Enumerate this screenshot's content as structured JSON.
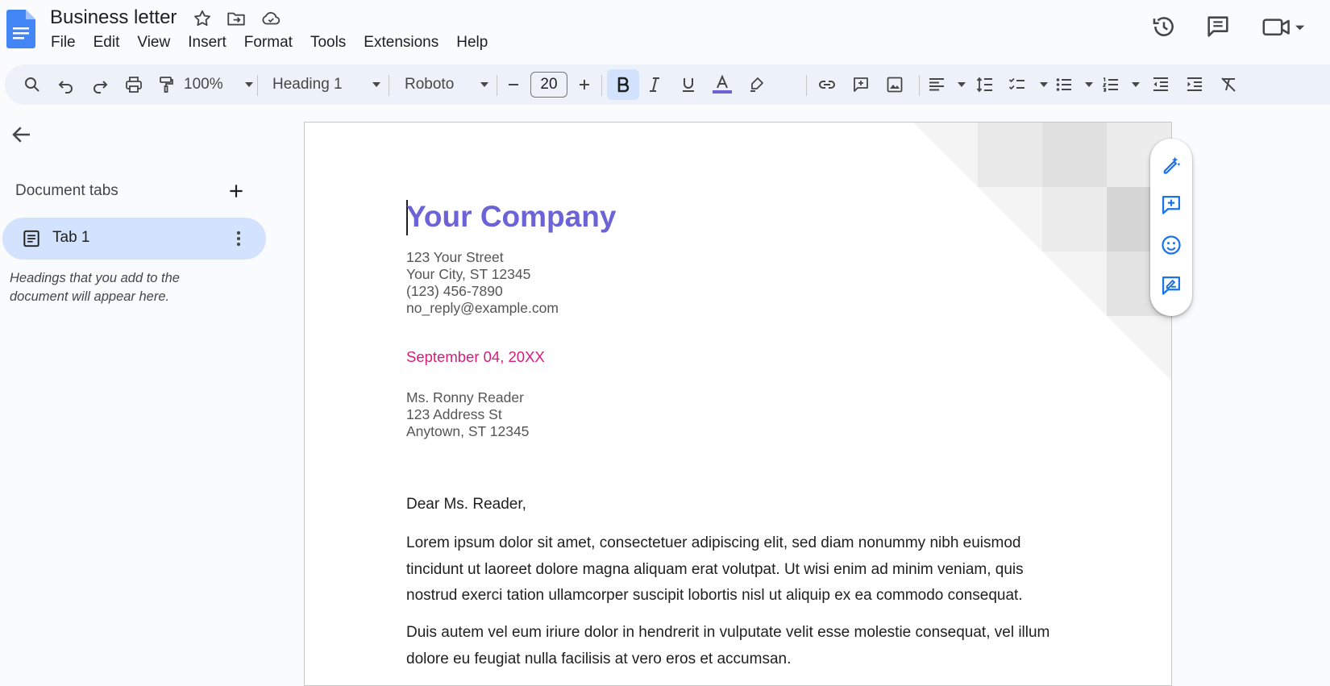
{
  "app": {
    "doc_title": "Business letter",
    "menu": [
      "File",
      "Edit",
      "View",
      "Insert",
      "Format",
      "Tools",
      "Extensions",
      "Help"
    ]
  },
  "toolbar": {
    "zoom": "100%",
    "style": "Heading 1",
    "font": "Roboto",
    "font_size": "20"
  },
  "sidebar": {
    "heading": "Document tabs",
    "tab_label": "Tab 1",
    "hint": "Headings that you add to the document will appear here."
  },
  "document": {
    "company": "Your Company",
    "sender_lines": [
      "123 Your Street",
      "Your City, ST 12345",
      "(123) 456-7890",
      "no_reply@example.com"
    ],
    "date": "September 04, 20XX",
    "recipient_lines": [
      "Ms. Ronny Reader",
      "123 Address St",
      "Anytown, ST 12345"
    ],
    "salutation": "Dear Ms. Reader,",
    "paragraphs": [
      "Lorem ipsum dolor sit amet, consectetuer adipiscing elit, sed diam nonummy nibh euismod tincidunt ut laoreet dolore magna aliquam erat volutpat. Ut wisi enim ad minim veniam, quis nostrud exerci tation ullamcorper suscipit lobortis nisl ut aliquip ex ea commodo consequat.",
      "Duis autem vel eum iriure dolor in hendrerit in vulputate velit esse molestie consequat, vel illum dolore eu feugiat nulla facilisis at vero eros et accumsan."
    ]
  },
  "colors": {
    "accent": "#1a73e8",
    "company": "#6b63d6",
    "date": "#d81b7a",
    "toolbar_bg": "#edf2fa",
    "tab_active": "#d3e3fd"
  },
  "icons": [
    "docs-logo-icon",
    "star-icon",
    "move-folder-icon",
    "cloud-icon",
    "history-icon",
    "comments-icon",
    "meet-icon",
    "search-icon",
    "undo-icon",
    "redo-icon",
    "print-icon",
    "paint-format-icon",
    "link-icon",
    "add-comment-icon",
    "image-icon",
    "align-left-icon",
    "line-spacing-icon",
    "checklist-icon",
    "bullet-list-icon",
    "numbered-list-icon",
    "indent-decrease-icon",
    "indent-increase-icon",
    "clear-format-icon",
    "edit-sparkle-icon",
    "emoji-icon",
    "suggest-edits-icon"
  ]
}
